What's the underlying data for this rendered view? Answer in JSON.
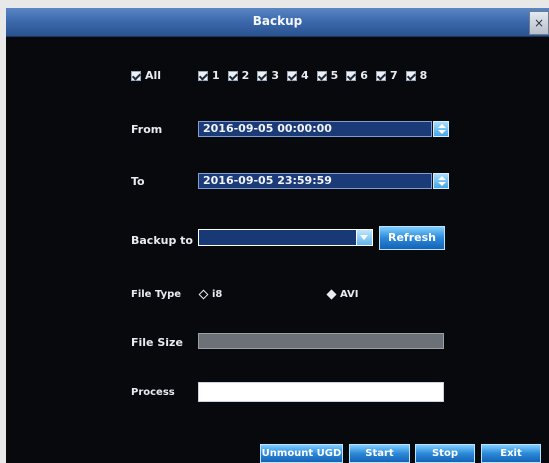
{
  "window": {
    "title": "Backup",
    "close_label": "×"
  },
  "channels": {
    "all_label": "All",
    "items": [
      "1",
      "2",
      "3",
      "4",
      "5",
      "6",
      "7",
      "8"
    ]
  },
  "from": {
    "label": "From",
    "value": "2016-09-05 00:00:00"
  },
  "to": {
    "label": "To",
    "value": "2016-09-05 23:59:59"
  },
  "backup_to": {
    "label": "Backup to",
    "value": "",
    "refresh_label": "Refresh"
  },
  "file_type": {
    "label": "File Type",
    "options": [
      "i8",
      "AVI"
    ],
    "selected": "AVI"
  },
  "file_size": {
    "label": "File Size"
  },
  "process": {
    "label": "Process",
    "progress": 0
  },
  "footer": {
    "unmount_label": "Unmount UGD",
    "start_label": "Start",
    "stop_label": "Stop",
    "exit_label": "Exit"
  }
}
